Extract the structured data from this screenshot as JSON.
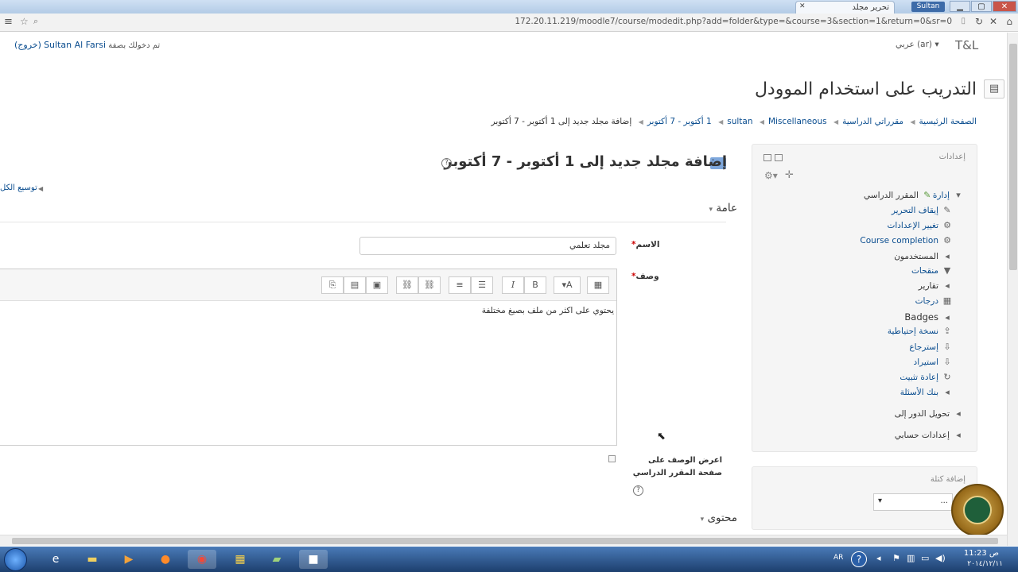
{
  "browser": {
    "tab_title": "تحرير مجلد",
    "user_chip": "Sultan",
    "url": "172.20.11.219/moodle7/course/modedit.php?add=folder&type=&course=3&section=1&return=0&sr=0"
  },
  "header": {
    "login_text": "تم دخولك بصفة",
    "login_user": "Sultan Al Farsi",
    "logout": "(خروج)",
    "lang": "عربي (ar)",
    "site_short": "T&L",
    "course_title": "التدريب على استخدام الموودل"
  },
  "breadcrumb": [
    {
      "label": "الصفحة الرئيسية",
      "link": true
    },
    {
      "label": "مقرراتي الدراسية",
      "link": true
    },
    {
      "label": "Miscellaneous",
      "link": true
    },
    {
      "label": "sultan",
      "link": true
    },
    {
      "label": "1 أكتوبر - 7 أكتوبر",
      "link": true
    },
    {
      "label": "إضافة مجلد جديد إلى 1 أكتوبر - 7 أكتوبر",
      "link": false
    }
  ],
  "settings": {
    "title": "إعدادات",
    "items": [
      {
        "label": "المقرر الدراسي",
        "prefix": "إدارة",
        "icon": "▾"
      },
      {
        "label": "إيقاف التحرير",
        "link": true,
        "icon": "✎"
      },
      {
        "label": "تغيير الإعدادات",
        "link": true,
        "icon": "⚙"
      },
      {
        "label": "Course completion",
        "link": true,
        "icon": "⚙"
      },
      {
        "label": "المستخدمون",
        "link": false,
        "icon": "◂"
      },
      {
        "label": "منقحات",
        "link": true,
        "icon": "▼"
      },
      {
        "label": "تقارير",
        "link": false,
        "icon": "◂"
      },
      {
        "label": "درجات",
        "link": true,
        "icon": "▦"
      },
      {
        "label": "Badges",
        "link": false,
        "icon": "◂"
      },
      {
        "label": "نسخة إحتياطية",
        "link": true,
        "icon": "⇪"
      },
      {
        "label": "إسترجاع",
        "link": true,
        "icon": "⇩"
      },
      {
        "label": "استيراد",
        "link": true,
        "icon": "⇩"
      },
      {
        "label": "إعادة تثبيت",
        "link": true,
        "icon": "↻"
      },
      {
        "label": "بنك الأسئلة",
        "link": true,
        "icon": "◂"
      },
      {
        "label": "تحويل الدور إلى",
        "link": false,
        "icon": "◂"
      },
      {
        "label": "إعدادات حسابي",
        "link": false,
        "icon": "◂"
      }
    ]
  },
  "addblock": {
    "title": "إضافة كتلة",
    "select_value": "..."
  },
  "main": {
    "heading": "إضافة مجلد جديد إلى 1 أكتوبر - 7 أكتوبر",
    "expand_all": "توسيع الكل",
    "section_general": "عامة",
    "name_label": "الاسم",
    "name_value": "مجلد تعلمي",
    "desc_label": "وصف",
    "desc_content": "يحتوي على اكثر من ملف بصيغ مختلفة",
    "show_desc_label": "اعرض الوصف على صفحة المقرر الدراسي",
    "section_content": "محتوى"
  },
  "taskbar": {
    "lang": "AR",
    "time": "11:23 ص",
    "date": "٢٠١٤/١٢/١١"
  }
}
